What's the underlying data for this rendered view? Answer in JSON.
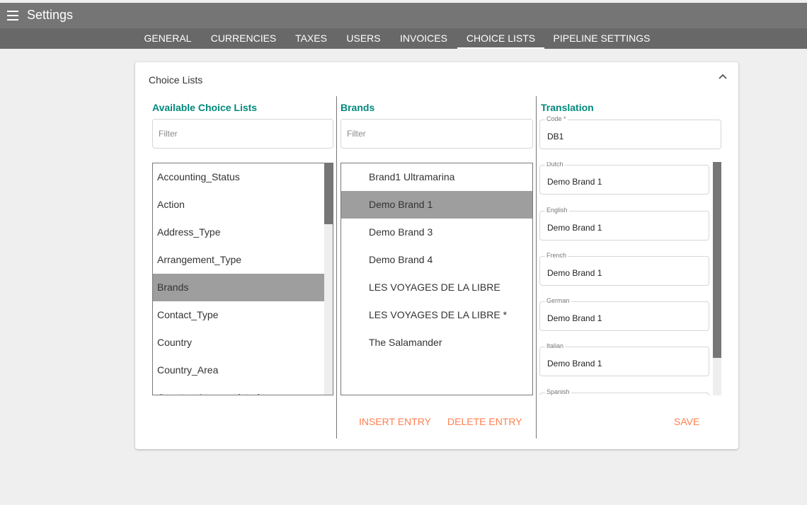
{
  "app": {
    "title": "Settings",
    "menu_icon": "hamburger-menu-icon"
  },
  "tabs": [
    {
      "label": "GENERAL"
    },
    {
      "label": "CURRENCIES"
    },
    {
      "label": "TAXES"
    },
    {
      "label": "USERS"
    },
    {
      "label": "INVOICES"
    },
    {
      "label": "CHOICE LISTS",
      "active": true
    },
    {
      "label": "PIPELINE SETTINGS"
    }
  ],
  "card": {
    "title": "Choice Lists",
    "collapse_icon": "chevron-up-icon"
  },
  "available": {
    "heading": "Available Choice Lists",
    "filter_placeholder": "Filter",
    "items": [
      "Accounting_Status",
      "Action",
      "Address_Type",
      "Arrangement_Type",
      "Brands",
      "Contact_Type",
      "Country",
      "Country_Area",
      "Country_Area_updated"
    ],
    "selected": "Brands"
  },
  "brands": {
    "heading": "Brands",
    "filter_placeholder": "Filter",
    "items": [
      "Brand1 Ultramarina",
      "Demo Brand 1",
      "Demo Brand 3",
      "Demo Brand 4",
      "LES VOYAGES DE LA LIBRE",
      "LES VOYAGES DE LA LIBRE *",
      "The Salamander"
    ],
    "selected": "Demo Brand 1",
    "insert_label": "INSERT ENTRY",
    "delete_label": "DELETE ENTRY"
  },
  "translation": {
    "heading": "Translation",
    "code_label": "Code *",
    "code_value": "DB1",
    "languages": [
      {
        "label": "Dutch",
        "value": "Demo Brand 1"
      },
      {
        "label": "English",
        "value": "Demo Brand 1"
      },
      {
        "label": "French",
        "value": "Demo Brand 1"
      },
      {
        "label": "German",
        "value": "Demo Brand 1"
      },
      {
        "label": "Italian",
        "value": "Demo Brand 1"
      },
      {
        "label": "Spanish",
        "value": ""
      }
    ],
    "save_label": "SAVE"
  },
  "colors": {
    "accent": "#00897b",
    "action": "#ff7f50",
    "selected": "#9e9e9e",
    "header": "#757575"
  }
}
